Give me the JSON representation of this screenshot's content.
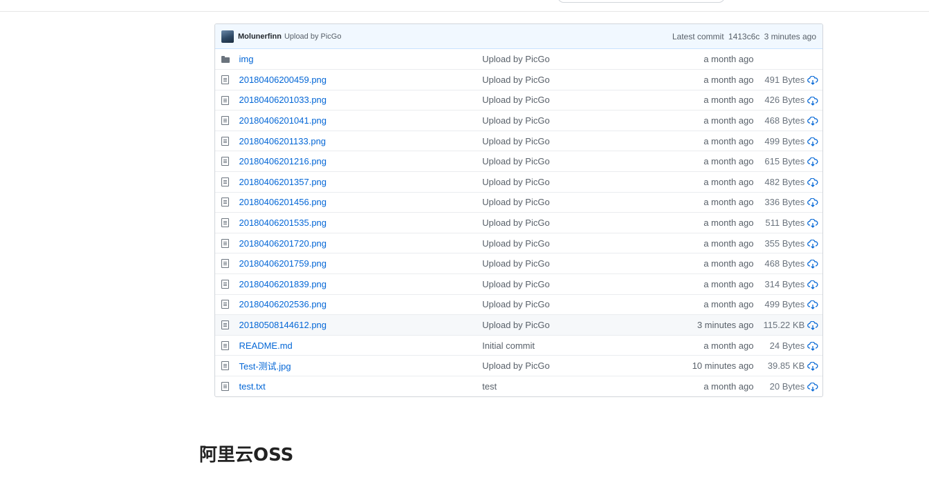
{
  "commit": {
    "author": "Molunerfinn",
    "message": "Upload by PicGo",
    "latest_label": "Latest commit",
    "sha": "1413c6c",
    "age": "3 minutes ago"
  },
  "files": [
    {
      "type": "folder",
      "name": "img",
      "message": "Upload by PicGo",
      "age": "a month ago",
      "size": ""
    },
    {
      "type": "file",
      "name": "20180406200459.png",
      "message": "Upload by PicGo",
      "age": "a month ago",
      "size": "491 Bytes"
    },
    {
      "type": "file",
      "name": "20180406201033.png",
      "message": "Upload by PicGo",
      "age": "a month ago",
      "size": "426 Bytes"
    },
    {
      "type": "file",
      "name": "20180406201041.png",
      "message": "Upload by PicGo",
      "age": "a month ago",
      "size": "468 Bytes"
    },
    {
      "type": "file",
      "name": "20180406201133.png",
      "message": "Upload by PicGo",
      "age": "a month ago",
      "size": "499 Bytes"
    },
    {
      "type": "file",
      "name": "20180406201216.png",
      "message": "Upload by PicGo",
      "age": "a month ago",
      "size": "615 Bytes"
    },
    {
      "type": "file",
      "name": "20180406201357.png",
      "message": "Upload by PicGo",
      "age": "a month ago",
      "size": "482 Bytes"
    },
    {
      "type": "file",
      "name": "20180406201456.png",
      "message": "Upload by PicGo",
      "age": "a month ago",
      "size": "336 Bytes"
    },
    {
      "type": "file",
      "name": "20180406201535.png",
      "message": "Upload by PicGo",
      "age": "a month ago",
      "size": "511 Bytes"
    },
    {
      "type": "file",
      "name": "20180406201720.png",
      "message": "Upload by PicGo",
      "age": "a month ago",
      "size": "355 Bytes"
    },
    {
      "type": "file",
      "name": "20180406201759.png",
      "message": "Upload by PicGo",
      "age": "a month ago",
      "size": "468 Bytes"
    },
    {
      "type": "file",
      "name": "20180406201839.png",
      "message": "Upload by PicGo",
      "age": "a month ago",
      "size": "314 Bytes"
    },
    {
      "type": "file",
      "name": "20180406202536.png",
      "message": "Upload by PicGo",
      "age": "a month ago",
      "size": "499 Bytes"
    },
    {
      "type": "file",
      "name": "20180508144612.png",
      "message": "Upload by PicGo",
      "age": "3 minutes ago",
      "size": "115.22 KB",
      "highlight": true
    },
    {
      "type": "file",
      "name": "README.md",
      "message": "Initial commit",
      "age": "a month ago",
      "size": "24 Bytes"
    },
    {
      "type": "file",
      "name": "Test-测试.jpg",
      "message": "Upload by PicGo",
      "age": "10 minutes ago",
      "size": "39.85 KB"
    },
    {
      "type": "file",
      "name": "test.txt",
      "message": "test",
      "age": "a month ago",
      "size": "20 Bytes"
    }
  ],
  "section_heading": "阿里云OSS",
  "colors": {
    "link": "#0366d6",
    "commit_bar_bg": "#f1f8ff",
    "muted_text": "#586069",
    "icon": "#6a737d",
    "download_icon": "#0366d6"
  },
  "icons": {
    "file": "file-icon",
    "folder": "folder-icon",
    "download": "cloud-download-icon"
  }
}
